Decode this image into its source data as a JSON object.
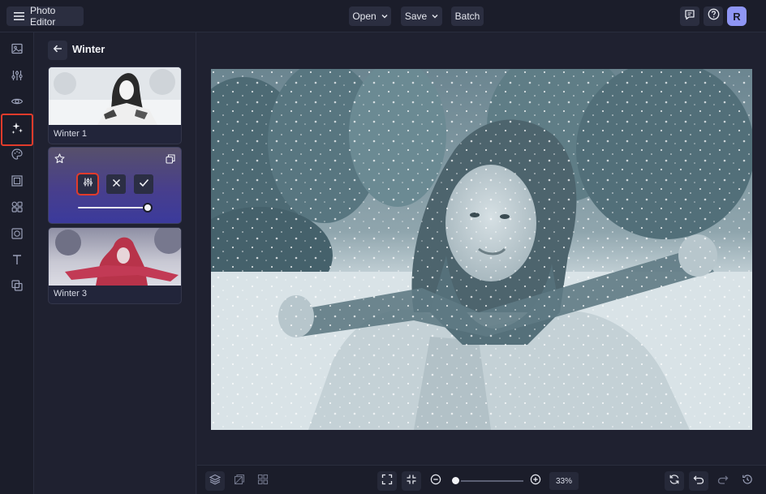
{
  "topbar": {
    "app_title": "Photo Editor",
    "open_label": "Open",
    "save_label": "Save",
    "batch_label": "Batch",
    "avatar_initial": "R"
  },
  "rail": {
    "items": [
      "image-icon",
      "sliders-icon",
      "eye-icon",
      "magic-wand-icon",
      "palette-icon",
      "frame-icon",
      "shapes-icon",
      "border-icon",
      "text-icon",
      "overlay-icon"
    ],
    "active_item": "magic-wand-icon"
  },
  "panel": {
    "title": "Winter",
    "presets": [
      {
        "label": "Winter 1"
      },
      {
        "label": ""
      },
      {
        "label": "Winter 3"
      }
    ],
    "intensity": 1.0
  },
  "zoom": {
    "value_label": "33%",
    "level": 0.05
  },
  "colors": {
    "accent": "#8f96f5",
    "highlight": "#e23b2b",
    "background": "#1f2130"
  }
}
